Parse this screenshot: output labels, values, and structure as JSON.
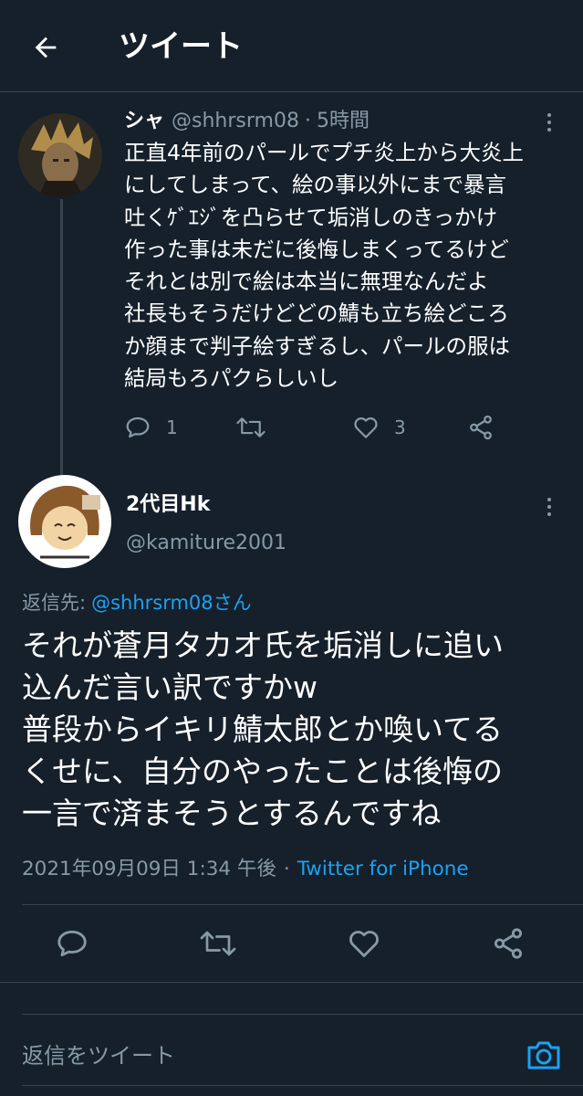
{
  "header": {
    "title": "ツイート"
  },
  "reply_tweet": {
    "display_name": "シャ",
    "handle": "@shhrsrm08",
    "separator": "·",
    "time_ago": "5時間",
    "text_lines": [
      "正直4年前のパールでプチ炎上から大炎上",
      "にしてしまって、絵の事以外にまで暴言",
      "吐くｹﾞｴｼﾞを凸らせて垢消しのきっかけ",
      "作った事は未だに後悔しまくってるけど",
      "それとは別で絵は本当に無理なんだよ",
      "社長もそうだけどどの鯖も立ち絵どころ",
      "か顔まで判子絵すぎるし、パールの服は",
      "結局もろパクらしいし"
    ],
    "reply_count": "1",
    "like_count": "3"
  },
  "main_tweet": {
    "display_name": "2代目Hk",
    "handle": "@kamiture2001",
    "replying_label": "返信先:",
    "replying_to": "@shhrsrm08さん",
    "text_lines": [
      "それが蒼月タカオ氏を垢消しに追い",
      "込んだ言い訳ですかw",
      "普段からイキリ鯖太郎とか喚いてる",
      "くせに、自分のやったことは後悔の",
      "一言で済まそうとするんですね"
    ],
    "timestamp": "2021年09月09日 1:34 午後",
    "separator": "·",
    "source": "Twitter for iPhone"
  },
  "composer": {
    "placeholder": "返信をツイート"
  },
  "colors": {
    "background": "#15202b",
    "text": "#ffffff",
    "secondary": "#8899a6",
    "accent": "#1da1f2",
    "divider": "#38444d"
  },
  "icons": [
    "back-arrow-icon",
    "more-icon",
    "reply-icon",
    "retweet-icon",
    "like-icon",
    "share-icon",
    "camera-icon"
  ]
}
